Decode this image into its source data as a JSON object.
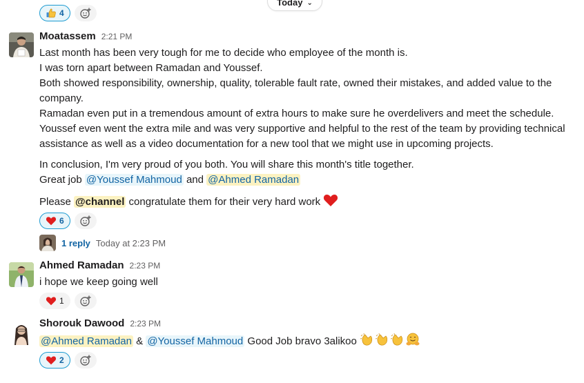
{
  "date_divider": {
    "label": "Today"
  },
  "top_reactions": [
    {
      "emoji": "thumbs-up",
      "count": "4"
    }
  ],
  "messages": [
    {
      "author": "Moatassem",
      "time": "2:21 PM",
      "lines": [
        "Last month has been very tough for me to decide who employee of the month is.",
        "I was torn apart between Ramadan and Youssef.",
        "Both showed responsibility, ownership, quality, tolerable fault rate, owned their mistakes, and added value to the",
        "company.",
        "Ramadan even put in a tremendous amount of extra hours to make sure he overdelivers and meet the schedule.",
        "Youssef even went the extra mile and was very supportive and helpful to the rest of the team by providing technical",
        "assistance as well as a video documentation for a new tool that we might use in upcoming projects."
      ],
      "conclusion": "In conclusion, I'm very proud of you both. You will share this month's title together.",
      "great_job": "Great job",
      "mention_1": "@Youssef Mahmoud",
      "and": "and",
      "mention_2": "@Ahmed Ramadan",
      "please": "Please",
      "channel": "@channel",
      "congrats": "congratulate them for their very hard work",
      "reactions": [
        {
          "emoji": "heart",
          "count": "6"
        }
      ],
      "thread": {
        "replies": "1 reply",
        "time": "Today at 2:23 PM"
      }
    },
    {
      "author": "Ahmed Ramadan",
      "time": "2:23 PM",
      "text": "i hope we keep going well",
      "reactions": [
        {
          "emoji": "heart",
          "count": "1"
        }
      ]
    },
    {
      "author": "Shorouk Dawood",
      "time": "2:23 PM",
      "mention_1": "@Ahmed Ramadan",
      "amp": "&",
      "mention_2": "@Youssef Mahmoud",
      "text": "Good Job bravo 3alikoo",
      "emojis": [
        "clapping-hands",
        "clapping-hands",
        "clapping-hands",
        "hugging-face"
      ],
      "reactions": [
        {
          "emoji": "heart",
          "count": "2"
        }
      ]
    }
  ],
  "colors": {
    "accent": "#1264a3",
    "mention_bg": "#fcf2c1",
    "heart": "#e01e1e"
  }
}
